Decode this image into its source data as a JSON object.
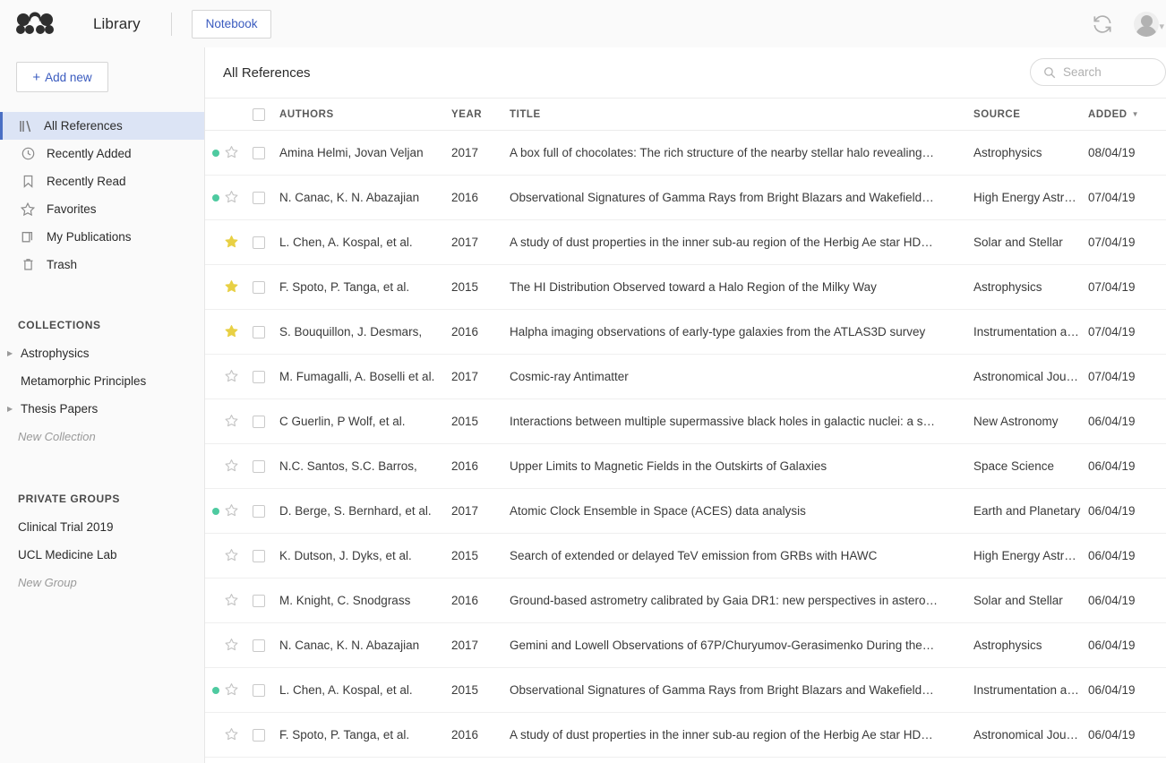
{
  "topbar": {
    "logo_name": "mendeley-logo",
    "app_title": "Library",
    "notebook_label": "Notebook",
    "sync_icon": "sync-icon",
    "avatar_label": "user-avatar"
  },
  "sidebar": {
    "add_new_label": "Add new",
    "add_new_plus": "+",
    "nav_items": [
      {
        "label": "All References",
        "icon": "all-references-icon",
        "active": true
      },
      {
        "label": "Recently Added",
        "icon": "clock-icon",
        "active": false
      },
      {
        "label": "Recently Read",
        "icon": "bookmark-icon",
        "active": false
      },
      {
        "label": "Favorites",
        "icon": "star-icon",
        "active": false
      },
      {
        "label": "My Publications",
        "icon": "documents-icon",
        "active": false
      },
      {
        "label": "Trash",
        "icon": "trash-icon",
        "active": false
      }
    ],
    "collections_title": "COLLECTIONS",
    "collections": [
      {
        "label": "Astrophysics",
        "expandable": true
      },
      {
        "label": "Metamorphic Principles",
        "expandable": false
      },
      {
        "label": "Thesis Papers",
        "expandable": true
      }
    ],
    "new_collection_label": "New Collection",
    "groups_title": "PRIVATE GROUPS",
    "groups": [
      {
        "label": "Clinical Trial 2019"
      },
      {
        "label": "UCL Medicine Lab"
      }
    ],
    "new_group_label": "New Group"
  },
  "main": {
    "title": "All References",
    "search_placeholder": "Search",
    "search_value": "",
    "columns": {
      "authors": "AUTHORS",
      "year": "YEAR",
      "title": "TITLE",
      "source": "SOURCE",
      "added": "ADDED"
    },
    "sort_column": "ADDED",
    "sort_direction": "desc",
    "rows": [
      {
        "unread": true,
        "favorite": false,
        "checked": false,
        "authors": "Amina Helmi, Jovan Veljan",
        "year": "2017",
        "title": "A box full of chocolates: The rich structure of the nearby stellar halo revealing…",
        "source": "Astrophysics",
        "added": "08/04/19"
      },
      {
        "unread": true,
        "favorite": false,
        "checked": false,
        "authors": "N. Canac, K. N. Abazajian",
        "year": "2016",
        "title": "Observational Signatures of Gamma Rays from Bright Blazars and Wakefield…",
        "source": "High Energy Astro…",
        "added": "07/04/19"
      },
      {
        "unread": false,
        "favorite": true,
        "checked": false,
        "authors": "L. Chen, A. Kospal, et al.",
        "year": "2017",
        "title": "A study of dust properties in the inner sub-au region of the Herbig Ae star HD…",
        "source": "Solar and Stellar",
        "added": "07/04/19"
      },
      {
        "unread": false,
        "favorite": true,
        "checked": false,
        "authors": "F. Spoto, P. Tanga, et al.",
        "year": "2015",
        "title": "The HI Distribution Observed toward a Halo Region of the Milky Way",
        "source": "Astrophysics",
        "added": "07/04/19"
      },
      {
        "unread": false,
        "favorite": true,
        "checked": false,
        "authors": "S. Bouquillon, J. Desmars,",
        "year": "2016",
        "title": "Halpha imaging observations of early-type galaxies from the ATLAS3D survey",
        "source": "Instrumentation an…",
        "added": "07/04/19"
      },
      {
        "unread": false,
        "favorite": false,
        "checked": false,
        "authors": "M. Fumagalli, A. Boselli et al.",
        "year": "2017",
        "title": "Cosmic-ray Antimatter",
        "source": "Astronomical Jour…",
        "added": "07/04/19"
      },
      {
        "unread": false,
        "favorite": false,
        "checked": false,
        "authors": "C Guerlin, P Wolf, et al.",
        "year": "2015",
        "title": "Interactions between multiple supermassive black holes in galactic nuclei: a s…",
        "source": "New Astronomy",
        "added": "06/04/19"
      },
      {
        "unread": false,
        "favorite": false,
        "checked": false,
        "authors": "N.C. Santos, S.C. Barros,",
        "year": "2016",
        "title": "Upper Limits to Magnetic Fields in the Outskirts of Galaxies",
        "source": "Space Science",
        "added": "06/04/19"
      },
      {
        "unread": true,
        "favorite": false,
        "checked": false,
        "authors": "D. Berge, S. Bernhard, et al.",
        "year": "2017",
        "title": "Atomic Clock Ensemble in Space (ACES) data analysis",
        "source": "Earth and Planetary",
        "added": "06/04/19"
      },
      {
        "unread": false,
        "favorite": false,
        "checked": false,
        "authors": "K. Dutson, J. Dyks, et al.",
        "year": "2015",
        "title": "Search of extended or delayed TeV emission from GRBs with HAWC",
        "source": "High Energy Astro…",
        "added": "06/04/19"
      },
      {
        "unread": false,
        "favorite": false,
        "checked": false,
        "authors": "M. Knight, C. Snodgrass",
        "year": "2016",
        "title": "Ground-based astrometry calibrated by Gaia DR1: new perspectives in astero…",
        "source": "Solar and Stellar",
        "added": "06/04/19"
      },
      {
        "unread": false,
        "favorite": false,
        "checked": false,
        "authors": "N. Canac, K. N. Abazajian",
        "year": "2017",
        "title": "Gemini and Lowell Observations of 67P/Churyumov-Gerasimenko During the…",
        "source": "Astrophysics",
        "added": "06/04/19"
      },
      {
        "unread": true,
        "favorite": false,
        "checked": false,
        "authors": "L. Chen, A. Kospal, et al.",
        "year": "2015",
        "title": "Observational Signatures of Gamma Rays from Bright Blazars and Wakefield…",
        "source": "Instrumentation an…",
        "added": "06/04/19"
      },
      {
        "unread": false,
        "favorite": false,
        "checked": false,
        "authors": "F. Spoto, P. Tanga, et al.",
        "year": "2016",
        "title": "A study of dust properties in the inner sub-au region of the Herbig Ae star HD…",
        "source": "Astronomical Jour…",
        "added": "06/04/19"
      }
    ]
  },
  "colors": {
    "accent_blue": "#3a5bbf",
    "selection_blue": "#dce4f5",
    "unread_green": "#4ecaa0",
    "favorite_yellow": "#e8d044"
  }
}
